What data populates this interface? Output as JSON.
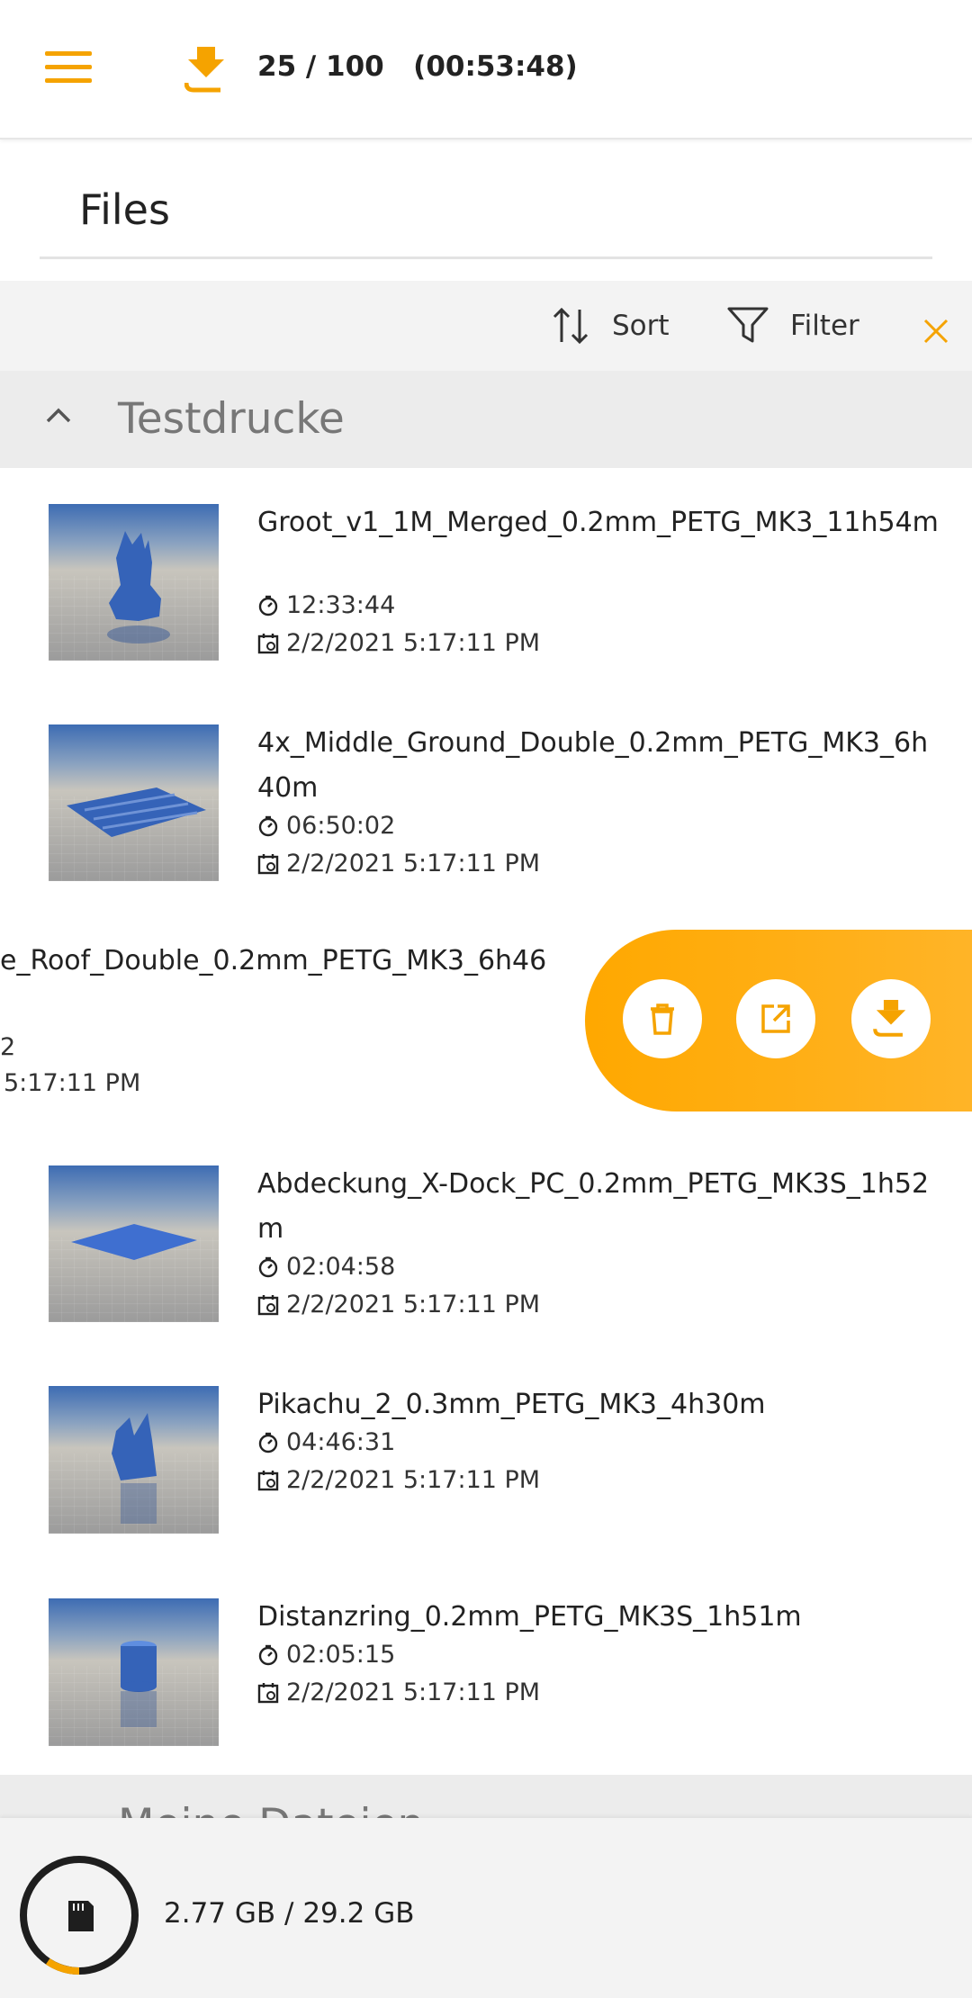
{
  "header": {
    "job_progress": "25 / 100",
    "job_time": "(00:53:48)",
    "accent_color": "#f5a300",
    "icons": {
      "menu": "hamburger-menu-icon",
      "job": "printer-download-icon"
    }
  },
  "page": {
    "title": "Files"
  },
  "toolbar": {
    "sort_label": "Sort",
    "filter_label": "Filter",
    "icons": {
      "sort": "sort-arrows-icon",
      "filter": "filter-funnel-icon",
      "clear": "close-icon"
    }
  },
  "section": {
    "title": "Testdrucke",
    "expanded": true
  },
  "files": [
    {
      "name": "Groot_v1_1M_Merged_0.2mm_PETG_MK3_11h54m",
      "duration": "12:33:44",
      "date": "2/2/2021 5:17:11 PM"
    },
    {
      "name": "4x_Middle_Ground_Double_0.2mm_PETG_MK3_6h40m",
      "duration": "06:50:02",
      "date": "2/2/2021 5:17:11 PM"
    },
    {
      "name": "Abdeckung_X-Dock_PC_0.2mm_PETG_MK3S_1h52m",
      "duration": "02:04:58",
      "date": "2/2/2021 5:17:11 PM"
    },
    {
      "name": "Pikachu_2_0.3mm_PETG_MK3_4h30m",
      "duration": "04:46:31",
      "date": "2/2/2021 5:17:11 PM"
    },
    {
      "name": "Distanzring_0.2mm_PETG_MK3S_1h51m",
      "duration": "02:05:15",
      "date": "2/2/2021 5:17:11 PM"
    }
  ],
  "swiped_file": {
    "name_visible": "e_Roof_Double_0.2mm_PETG_MK3_6h46",
    "duration_visible": "2",
    "date_visible": "5:17:11 PM",
    "actions": [
      "trash-icon",
      "open-external-icon",
      "print-download-icon"
    ]
  },
  "next_section": {
    "title": "Meine Dateien"
  },
  "storage": {
    "used": "2.77 GB / 29.2 GB",
    "fraction_used": 0.095,
    "icon": "sd-card-icon"
  }
}
